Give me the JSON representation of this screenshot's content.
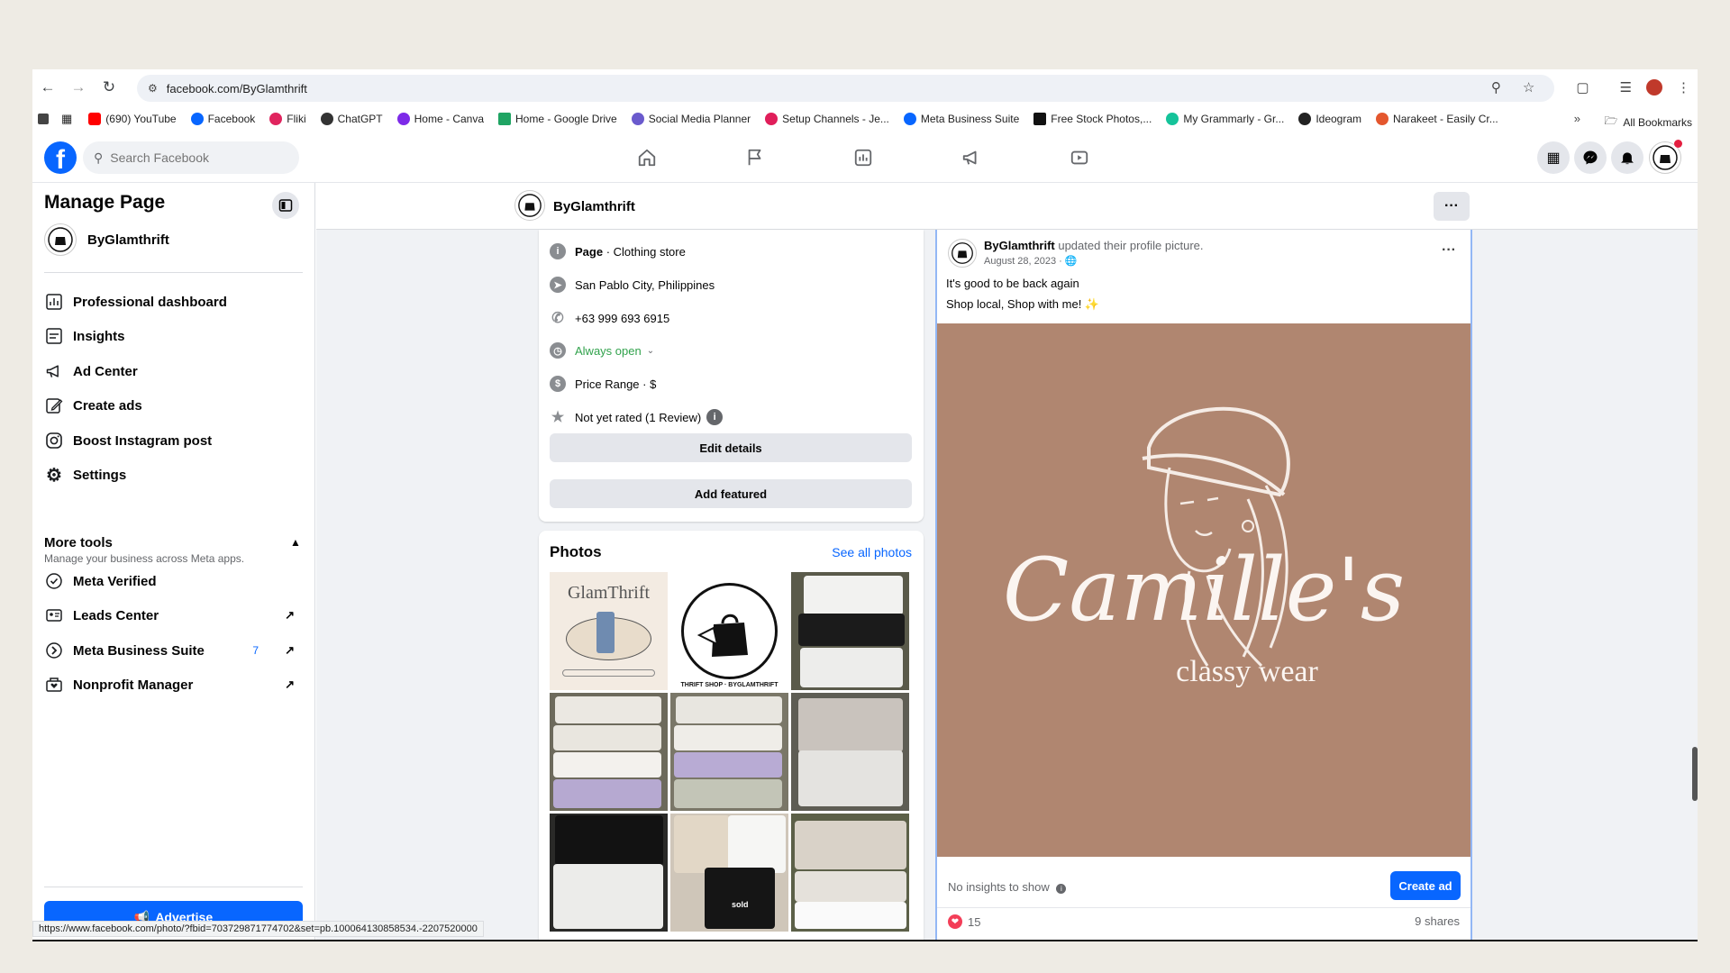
{
  "browser": {
    "url": "facebook.com/ByGlamthrift",
    "bookmarks": [
      {
        "label": "(690) YouTube",
        "color": "#ff0000"
      },
      {
        "label": "Facebook",
        "color": "#0866ff"
      },
      {
        "label": "Fliki",
        "color": "#e0245e"
      },
      {
        "label": "ChatGPT",
        "color": "#333333"
      },
      {
        "label": "Home - Canva",
        "color": "#7d2ae8"
      },
      {
        "label": "Home - Google Drive",
        "color": "#1fa463"
      },
      {
        "label": "Social Media Planner",
        "color": "#6a5acd"
      },
      {
        "label": "Setup Channels - Je...",
        "color": "#e01e5a"
      },
      {
        "label": "Meta Business Suite",
        "color": "#0866ff"
      },
      {
        "label": "Free Stock Photos,...",
        "color": "#111111"
      },
      {
        "label": "My Grammarly - Gr...",
        "color": "#15c39a"
      },
      {
        "label": "Ideogram",
        "color": "#222222"
      },
      {
        "label": "Narakeet - Easily Cr...",
        "color": "#e4572e"
      }
    ],
    "all_bookmarks": "All Bookmarks",
    "status_url": "https://www.facebook.com/photo/?fbid=703729871774702&set=pb.100064130858534.-2207520000"
  },
  "fb": {
    "search_placeholder": "Search Facebook"
  },
  "sidebar": {
    "title": "Manage Page",
    "page_name": "ByGlamthrift",
    "items": [
      {
        "label": "Professional dashboard"
      },
      {
        "label": "Insights"
      },
      {
        "label": "Ad Center"
      },
      {
        "label": "Create ads"
      },
      {
        "label": "Boost Instagram post"
      },
      {
        "label": "Settings"
      }
    ],
    "more_tools": "More tools",
    "more_tools_sub": "Manage your business across Meta apps.",
    "tools": [
      {
        "label": "Meta Verified"
      },
      {
        "label": "Leads Center"
      },
      {
        "label": "Meta Business Suite",
        "badge": "7"
      },
      {
        "label": "Nonprofit Manager"
      }
    ],
    "advertise": "Advertise"
  },
  "page_header": {
    "name": "ByGlamthrift"
  },
  "about": {
    "category_label": "Page",
    "category": " · Clothing store",
    "location": "San Pablo City, Philippines",
    "phone": "+63 999 693 6915",
    "hours": "Always open",
    "price": "Price Range · $",
    "rating": "Not yet rated (1 Review)",
    "edit_details": "Edit details",
    "add_featured": "Add featured"
  },
  "photos": {
    "title": "Photos",
    "see_all": "See all photos",
    "tile1_text": "GlamThrift",
    "tile2_text": "THRIFT SHOP · BYGLAMTHRIFT",
    "tile8_text": "sold"
  },
  "post": {
    "author": "ByGlamthrift",
    "action": " updated their profile picture.",
    "date": "August 28, 2023 · ",
    "text1": "It's good to be back again",
    "text2": "Shop local, Shop with me! ✨",
    "image_title": "Camille's",
    "image_subtitle": "classy wear",
    "no_insights": "No insights to show",
    "create_ad": "Create ad",
    "reactions": "15",
    "shares": "9 shares"
  }
}
